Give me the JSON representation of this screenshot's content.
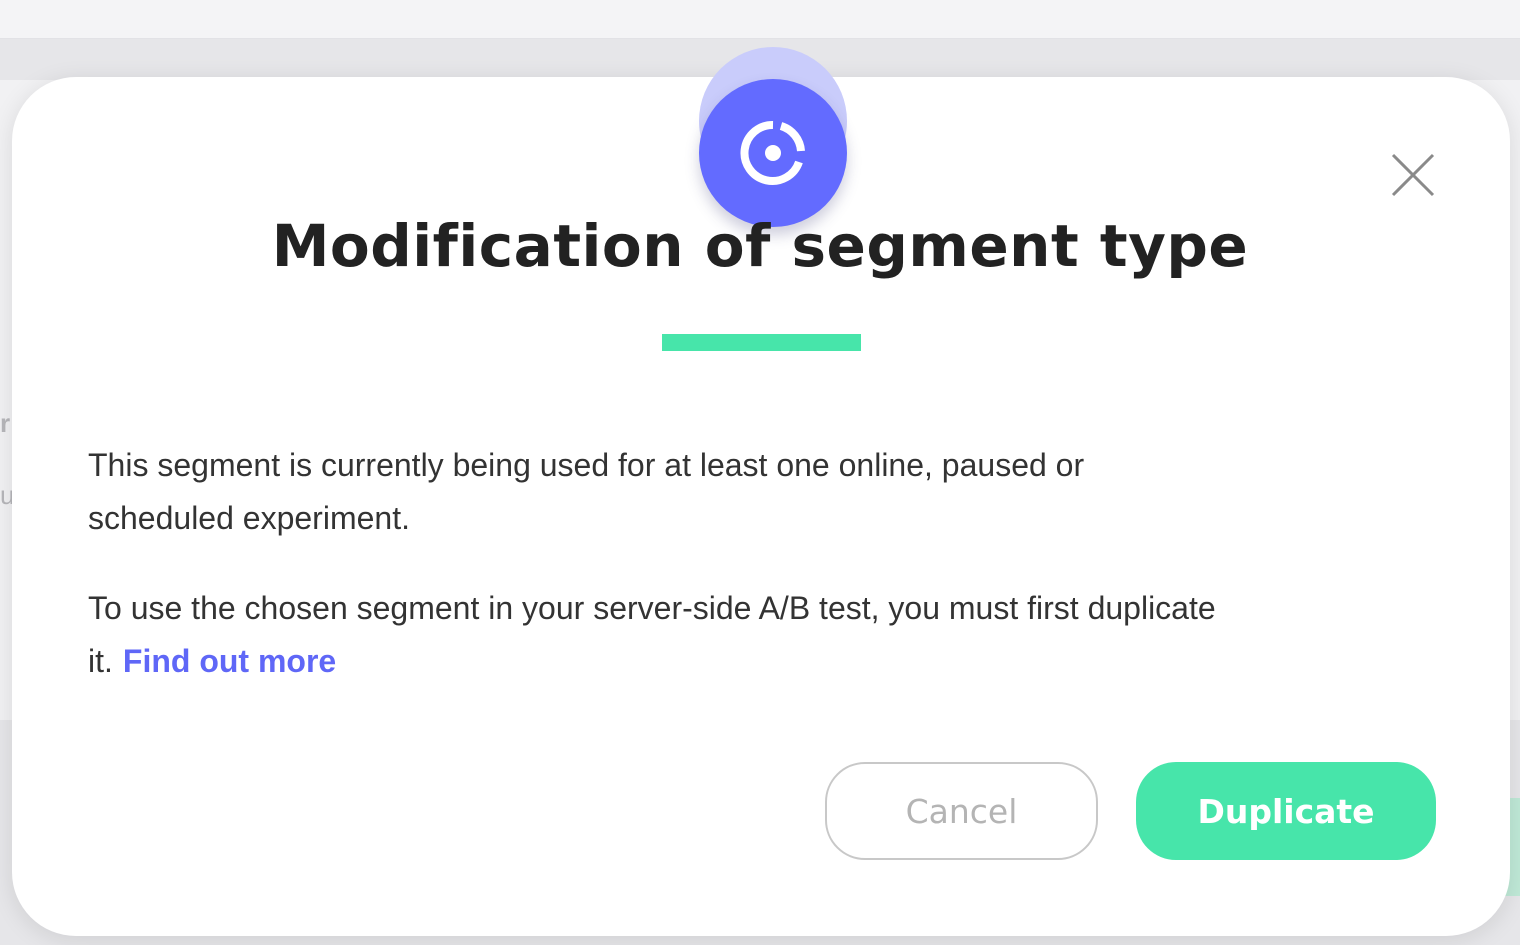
{
  "background": {
    "partial_text_1": "r",
    "partial_text_2": "u"
  },
  "modal": {
    "icon": "target-icon",
    "close_icon": "close-icon",
    "title": "Modification of segment type",
    "paragraph_1": "This segment is currently being used for at least one online, paused or scheduled experiment.",
    "paragraph_2": "To use the chosen segment in your server-side A/B test, you must first duplicate it.",
    "link_label": "Find out more",
    "cancel_label": "Cancel",
    "duplicate_label": "Duplicate"
  },
  "colors": {
    "accent_primary": "#636bff",
    "accent_success": "#47e5aa",
    "link": "#5f67f7"
  }
}
